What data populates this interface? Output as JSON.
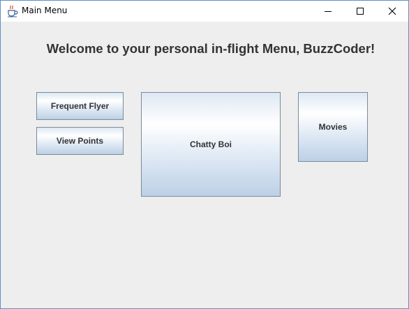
{
  "window": {
    "title": "Main Menu",
    "icon": "java-coffee-cup-icon",
    "controls": {
      "minimize": "minimize-icon",
      "maximize": "maximize-icon",
      "close": "close-icon"
    }
  },
  "main": {
    "heading": "Welcome to your personal in-flight Menu, BuzzCoder!",
    "buttons": {
      "frequent_flyer": "Frequent Flyer",
      "view_points": "View Points",
      "chatty_boi": "Chatty Boi",
      "movies": "Movies"
    }
  },
  "colors": {
    "background": "#eeeeee",
    "button_text": "#333333",
    "window_border": "#5d8fc4"
  }
}
